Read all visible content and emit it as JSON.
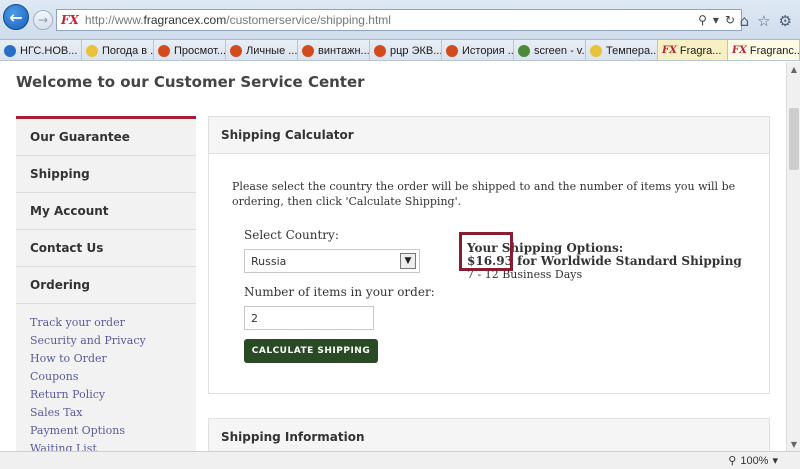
{
  "browser": {
    "url_prefix": "http://www.",
    "url_host": "fragrancex.com",
    "url_path": "/customerservice/shipping.html",
    "logo": "FX",
    "tabs": [
      {
        "label": "НГС.НОВ...",
        "color": "#2a6fc7"
      },
      {
        "label": "Погода в ...",
        "color": "#e8c23a"
      },
      {
        "label": "Просмот...",
        "color": "#d24a1e"
      },
      {
        "label": "Личные ...",
        "color": "#d24a1e"
      },
      {
        "label": "винтажн...",
        "color": "#d24a1e"
      },
      {
        "label": "рцр ЭКВ...",
        "color": "#d24a1e"
      },
      {
        "label": "История ...",
        "color": "#d24a1e"
      },
      {
        "label": "screen - v...",
        "color": "#4a8a3a"
      },
      {
        "label": "Темпера...",
        "color": "#e8c23a"
      },
      {
        "label": "Fragra...",
        "color": "#c0243a"
      },
      {
        "label": "Fragranc...",
        "color": "#c0243a"
      }
    ],
    "zoom": "100%"
  },
  "page": {
    "title": "Welcome to our Customer Service Center",
    "sidebar": {
      "items": [
        "Our Guarantee",
        "Shipping",
        "My Account",
        "Contact Us",
        "Ordering"
      ],
      "links": [
        "Track your order",
        "Security and Privacy",
        "How to Order",
        "Coupons",
        "Return Policy",
        "Sales Tax",
        "Payment Options",
        "Waiting List"
      ]
    },
    "calculator": {
      "heading": "Shipping Calculator",
      "intro": "Please select the country the order will be shipped to and the number of items you will be ordering, then click 'Calculate Shipping'.",
      "country_label": "Select Country:",
      "country_value": "Russia",
      "qty_label": "Number of items in your order:",
      "qty_value": "2",
      "button": "CALCULATE SHIPPING",
      "options_heading": "Your Shipping Options:",
      "price": "$16.93",
      "price_rest": " for Worldwide Standard Shipping",
      "days": "7 - 12 Business Days"
    },
    "info_heading": "Shipping Information"
  },
  "colors": {
    "accent": "#a51d35",
    "button": "#2a4a25",
    "highlight": "#861d30",
    "link": "#5a5aa0"
  }
}
